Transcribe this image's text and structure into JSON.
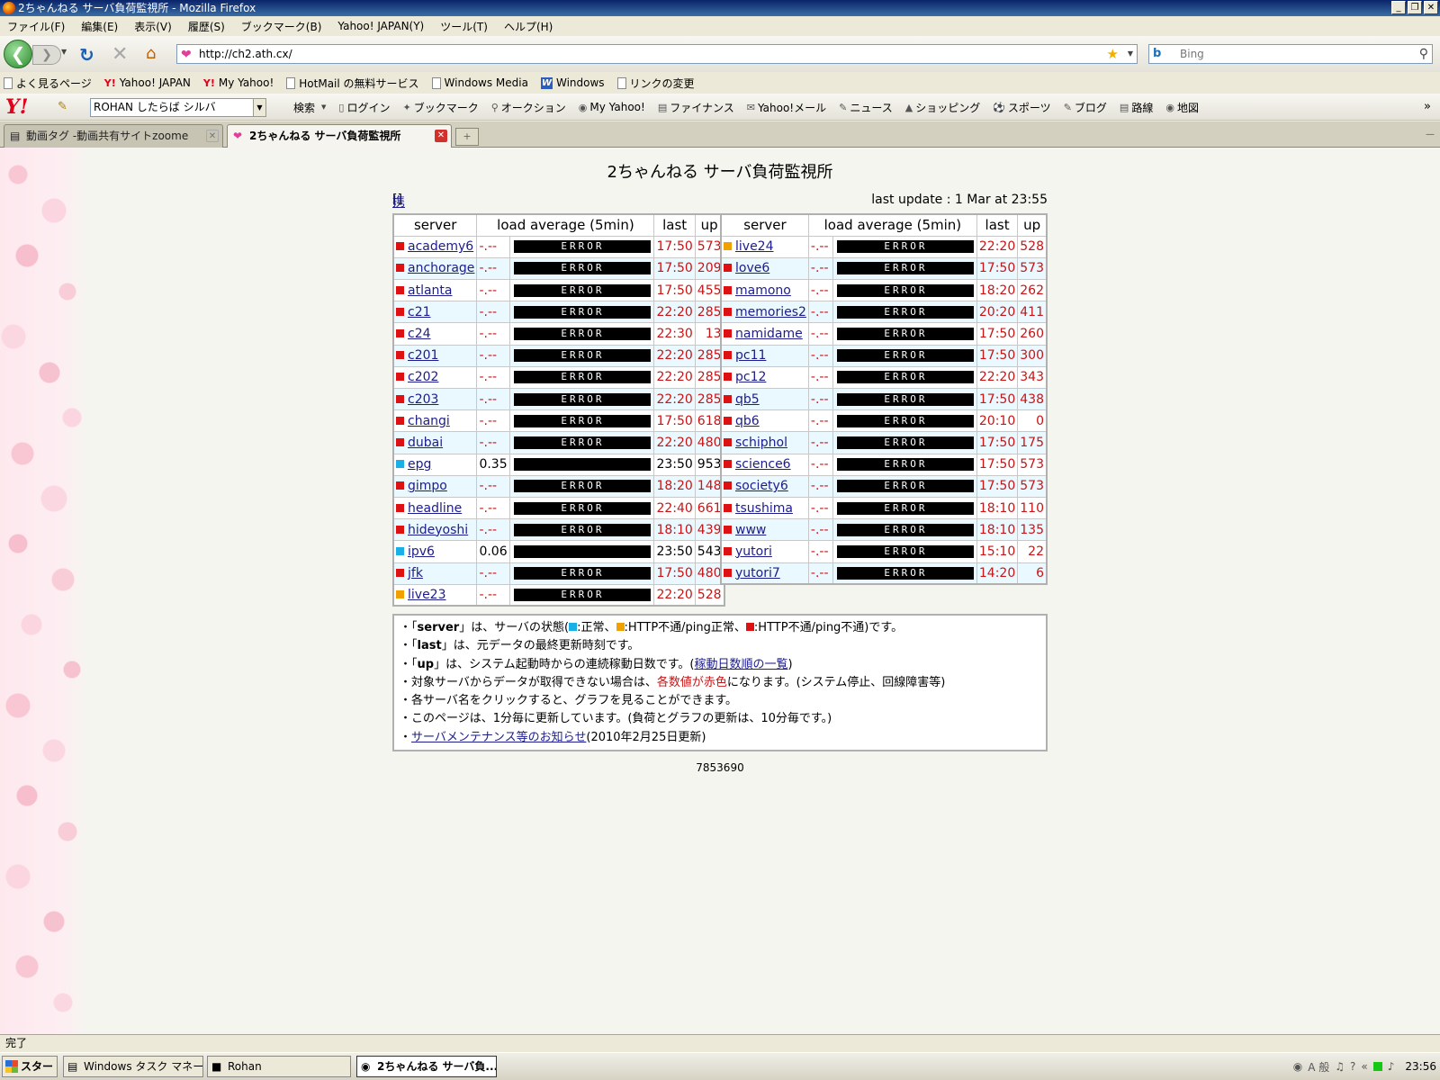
{
  "window": {
    "title": "2ちゃんねる サーバ負荷監視所 - Mozilla Firefox",
    "buttons": [
      "_",
      "❐",
      "✕"
    ]
  },
  "menu": [
    "ファイル(F)",
    "編集(E)",
    "表示(V)",
    "履歴(S)",
    "ブックマーク(B)",
    "Yahoo! JAPAN(Y)",
    "ツール(T)",
    "ヘルプ(H)"
  ],
  "nav": {
    "url": "http://ch2.ath.cx/",
    "search_placeholder": "Bing",
    "search_engine_icon": "b"
  },
  "bookmarks": [
    {
      "label": "よく見るページ",
      "icon": "page-icon"
    },
    {
      "label": "Yahoo! JAPAN",
      "icon": "yahoo-icon"
    },
    {
      "label": "My Yahoo!",
      "icon": "yahoo-icon"
    },
    {
      "label": "HotMail の無料サービス",
      "icon": "doc-icon"
    },
    {
      "label": "Windows Media",
      "icon": "doc-icon"
    },
    {
      "label": "Windows",
      "icon": "windows-icon"
    },
    {
      "label": "リンクの変更",
      "icon": "doc-icon"
    }
  ],
  "yahoo_toolbar": {
    "logo": "Y!",
    "search_value": "ROHAN したらば シルバ",
    "links": [
      "検索",
      "ログイン",
      "ブックマーク",
      "オークション",
      "My Yahoo!",
      "ファイナンス",
      "Yahoo!メール",
      "ニュース",
      "ショッピング",
      "スポーツ",
      "ブログ",
      "路線",
      "地図"
    ]
  },
  "tabs": [
    {
      "label": "動画タグ -動画共有サイトzoome",
      "active": false
    },
    {
      "label": "2ちゃんねる サーバ負荷監視所",
      "active": true
    }
  ],
  "page": {
    "title": "2ちゃんねる サーバ負荷監視所",
    "mobile_link": "携帯入り口",
    "last_update": "last update : 1 Mar at 23:55",
    "headers": {
      "server": "server",
      "load": "load average (5min)",
      "last": "last",
      "up": "up"
    },
    "error_text": "ERROR",
    "dash": "-.--",
    "colors": {
      "ok": "#1ab0e6",
      "warn": "#f0a000",
      "down": "#dd1111"
    },
    "left": [
      {
        "name": "academy6",
        "status": "down",
        "load": "-.--",
        "last": "17:50",
        "up": "573"
      },
      {
        "name": "anchorage",
        "status": "down",
        "load": "-.--",
        "last": "17:50",
        "up": "209"
      },
      {
        "name": "atlanta",
        "status": "down",
        "load": "-.--",
        "last": "17:50",
        "up": "455"
      },
      {
        "name": "c21",
        "status": "down",
        "load": "-.--",
        "last": "22:20",
        "up": "285"
      },
      {
        "name": "c24",
        "status": "down",
        "load": "-.--",
        "last": "22:30",
        "up": "13"
      },
      {
        "name": "c201",
        "status": "down",
        "load": "-.--",
        "last": "22:20",
        "up": "285"
      },
      {
        "name": "c202",
        "status": "down",
        "load": "-.--",
        "last": "22:20",
        "up": "285"
      },
      {
        "name": "c203",
        "status": "down",
        "load": "-.--",
        "last": "22:20",
        "up": "285"
      },
      {
        "name": "changi",
        "status": "down",
        "load": "-.--",
        "last": "17:50",
        "up": "618"
      },
      {
        "name": "dubai",
        "status": "down",
        "load": "-.--",
        "last": "22:20",
        "up": "480"
      },
      {
        "name": "epg",
        "status": "ok",
        "load": "0.35",
        "last": "23:50",
        "up": "953"
      },
      {
        "name": "gimpo",
        "status": "down",
        "load": "-.--",
        "last": "18:20",
        "up": "148"
      },
      {
        "name": "headline",
        "status": "down",
        "load": "-.--",
        "last": "22:40",
        "up": "661"
      },
      {
        "name": "hideyoshi",
        "status": "down",
        "load": "-.--",
        "last": "18:10",
        "up": "439"
      },
      {
        "name": "ipv6",
        "status": "ok",
        "load": "0.06",
        "last": "23:50",
        "up": "543"
      },
      {
        "name": "jfk",
        "status": "down",
        "load": "-.--",
        "last": "17:50",
        "up": "480"
      },
      {
        "name": "live23",
        "status": "warn",
        "load": "-.--",
        "last": "22:20",
        "up": "528"
      }
    ],
    "right": [
      {
        "name": "live24",
        "status": "warn",
        "load": "-.--",
        "last": "22:20",
        "up": "528"
      },
      {
        "name": "love6",
        "status": "down",
        "load": "-.--",
        "last": "17:50",
        "up": "573"
      },
      {
        "name": "mamono",
        "status": "down",
        "load": "-.--",
        "last": "18:20",
        "up": "262"
      },
      {
        "name": "memories2",
        "status": "down",
        "load": "-.--",
        "last": "20:20",
        "up": "411"
      },
      {
        "name": "namidame",
        "status": "down",
        "load": "-.--",
        "last": "17:50",
        "up": "260"
      },
      {
        "name": "pc11",
        "status": "down",
        "load": "-.--",
        "last": "17:50",
        "up": "300"
      },
      {
        "name": "pc12",
        "status": "down",
        "load": "-.--",
        "last": "22:20",
        "up": "343"
      },
      {
        "name": "qb5",
        "status": "down",
        "load": "-.--",
        "last": "17:50",
        "up": "438"
      },
      {
        "name": "qb6",
        "status": "down",
        "load": "-.--",
        "last": "20:10",
        "up": "0"
      },
      {
        "name": "schiphol",
        "status": "down",
        "load": "-.--",
        "last": "17:50",
        "up": "175"
      },
      {
        "name": "science6",
        "status": "down",
        "load": "-.--",
        "last": "17:50",
        "up": "573"
      },
      {
        "name": "society6",
        "status": "down",
        "load": "-.--",
        "last": "17:50",
        "up": "573"
      },
      {
        "name": "tsushima",
        "status": "down",
        "load": "-.--",
        "last": "18:10",
        "up": "110"
      },
      {
        "name": "www",
        "status": "down",
        "load": "-.--",
        "last": "18:10",
        "up": "135"
      },
      {
        "name": "yutori",
        "status": "down",
        "load": "-.--",
        "last": "15:10",
        "up": "22"
      },
      {
        "name": "yutori7",
        "status": "down",
        "load": "-.--",
        "last": "14:20",
        "up": "6"
      }
    ],
    "notes": {
      "n1_a": "・「",
      "n1_b": "server",
      "n1_c": "」は、サーバの状態(",
      "n1_ok": ":正常、",
      "n1_warn": ":HTTP不通/ping正常、",
      "n1_down": ":HTTP不通/ping不通)です。",
      "n2_a": "・「",
      "n2_b": "last",
      "n2_c": "」は、元データの最終更新時刻です。",
      "n3_a": "・「",
      "n3_b": "up",
      "n3_c": "」は、システム起動時からの連続稼動日数です。(",
      "n3_link": "稼動日数順の一覧",
      "n3_d": ")",
      "n4_a": "・対象サーバからデータが取得できない場合は、",
      "n4_red": "各数値が赤色",
      "n4_b": "になります。(システム停止、回線障害等)",
      "n5": "・各サーバ名をクリックすると、グラフを見ることができます。",
      "n6": "・このページは、1分毎に更新しています。(負荷とグラフの更新は、10分毎です。)",
      "n7_a": "・",
      "n7_link": "サーバメンテナンス等のお知らせ",
      "n7_b": "(2010年2月25日更新)"
    },
    "counter": "7853690"
  },
  "statusbar": {
    "text": "完了"
  },
  "taskbar": {
    "start": "スタート",
    "items": [
      {
        "label": "Windows タスク マネージャ",
        "active": false
      },
      {
        "label": "Rohan",
        "active": false
      },
      {
        "label": "2ちゃんねる サーバ負...",
        "active": true
      }
    ],
    "tray_ime": "A 般",
    "clock": "23:56"
  }
}
